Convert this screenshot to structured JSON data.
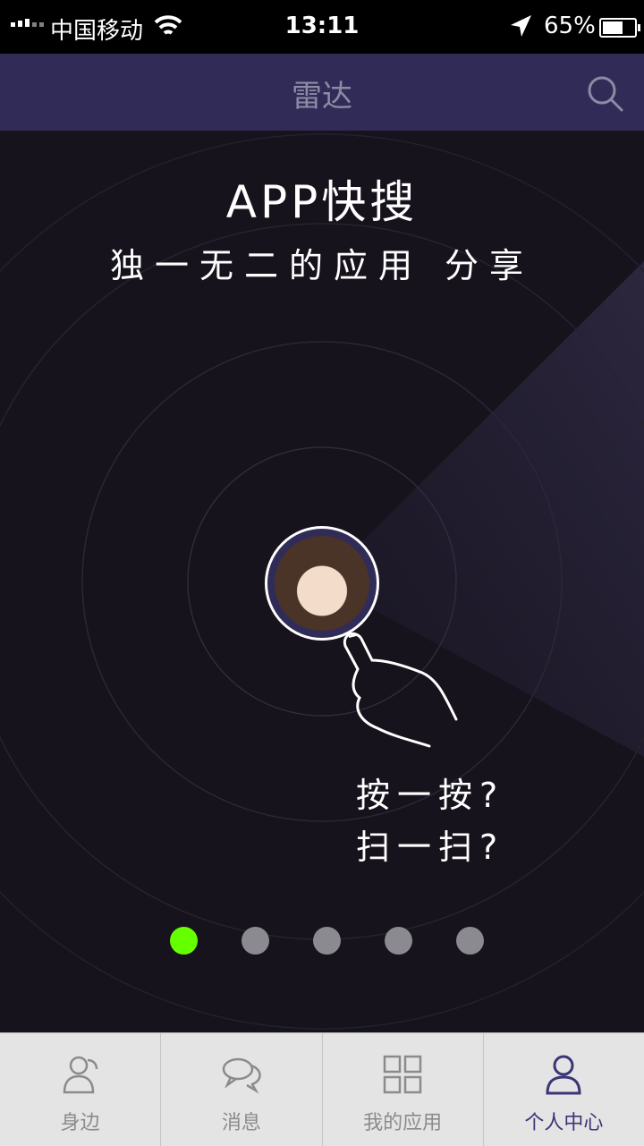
{
  "status_bar": {
    "carrier": "中国移动",
    "time": "13:11",
    "battery": "65%",
    "battery_level": 0.65
  },
  "nav": {
    "title": "雷达"
  },
  "intro": {
    "headline": "APP快搜",
    "subline": "独一无二的应用 分享",
    "prompt_line1": "按一按?",
    "prompt_line2": "扫一扫?"
  },
  "pager": {
    "count": 5,
    "active_index": 0
  },
  "tabs": [
    {
      "label": "身边",
      "icon": "person-icon"
    },
    {
      "label": "消息",
      "icon": "chat-bubbles-icon"
    },
    {
      "label": "我的应用",
      "icon": "app-grid-icon"
    },
    {
      "label": "个人中心",
      "icon": "user-icon"
    }
  ],
  "colors": {
    "nav_background": "#312c57",
    "active_dot": "#66ff00",
    "active_tab": "#3a3576"
  }
}
